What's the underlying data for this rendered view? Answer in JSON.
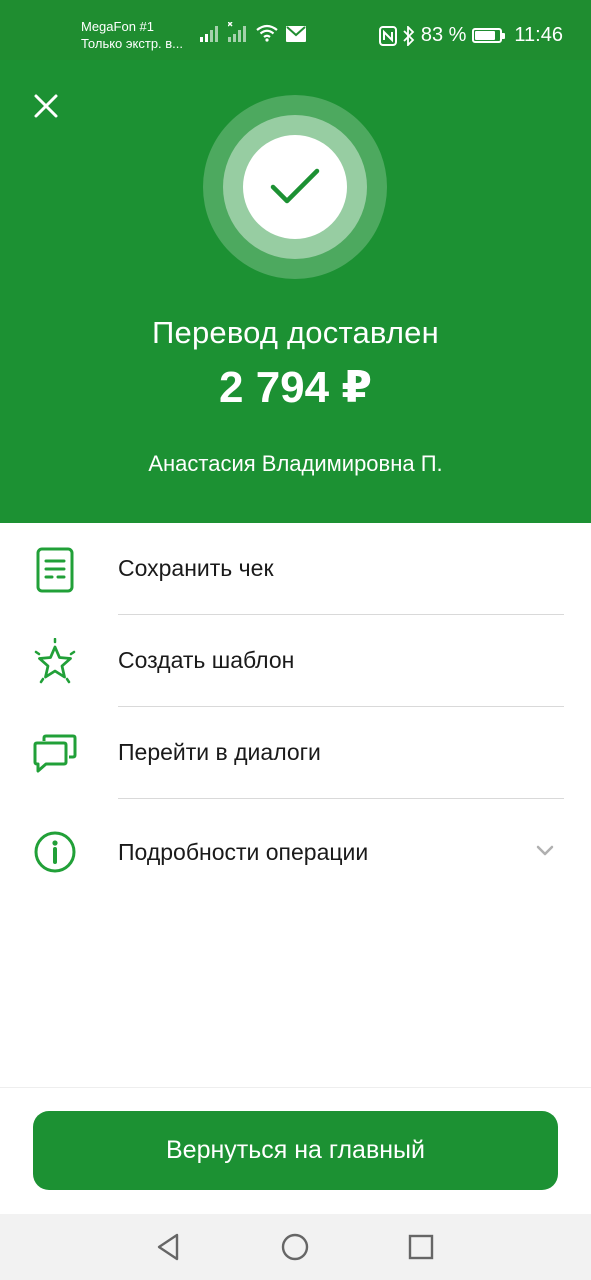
{
  "status_bar": {
    "carrier": "MegaFon #1",
    "carrier_sub": "Только экстр. в...",
    "battery_percent": "83 %",
    "battery_level": 0.83,
    "time": "11:46"
  },
  "hero": {
    "title": "Перевод доставлен",
    "amount": "2 794 ₽",
    "recipient": "Анастасия Владимировна П."
  },
  "actions": [
    {
      "label": "Сохранить чек",
      "icon": "receipt-icon"
    },
    {
      "label": "Создать шаблон",
      "icon": "star-icon"
    },
    {
      "label": "Перейти в диалоги",
      "icon": "chat-icon"
    },
    {
      "label": "Подробности операции",
      "icon": "info-icon",
      "expandable": true
    }
  ],
  "main_button": {
    "label": "Вернуться на главный"
  },
  "colors": {
    "brand_green": "#1c9133",
    "status_green": "#1f8d30",
    "icon_green": "#21a038"
  }
}
